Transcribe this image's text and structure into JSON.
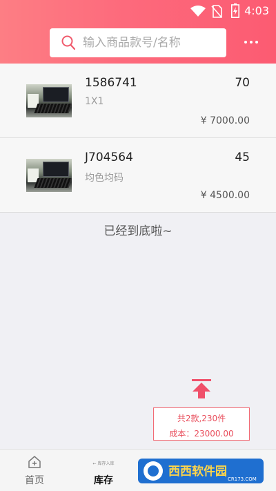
{
  "status_bar": {
    "time": "4:03"
  },
  "search": {
    "placeholder": "输入商品款号/名称"
  },
  "products": [
    {
      "code": "1586741",
      "quantity": "70",
      "spec": "1X1",
      "price": "¥ 7000.00"
    },
    {
      "code": "J704564",
      "quantity": "45",
      "spec": "均色均码",
      "price": "¥ 4500.00"
    }
  ],
  "end_of_list": "已经到底啦~",
  "summary": {
    "count_line": "共2款,230件",
    "cost_line": "成本：23000.00"
  },
  "tabs": [
    {
      "label": "首页",
      "active": false
    },
    {
      "label": "库存",
      "active": true,
      "tiny_label": "← 库存入库"
    }
  ],
  "watermark": {
    "site_cn": "西西软件园",
    "site_url": "CR173.COM"
  },
  "colors": {
    "header_start": "#fd7e84",
    "header_end": "#fc5b72",
    "accent": "#f0506a",
    "summary_text": "#e94f5d"
  }
}
